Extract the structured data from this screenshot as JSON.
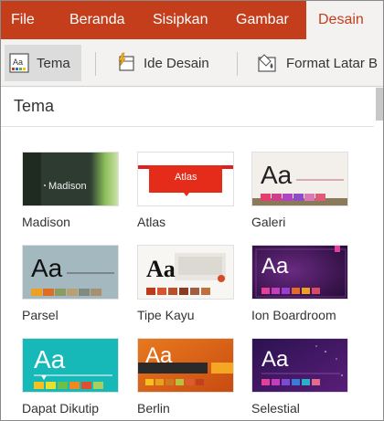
{
  "ribbon": {
    "tabs": [
      {
        "label": "File"
      },
      {
        "label": "Beranda"
      },
      {
        "label": "Sisipkan"
      },
      {
        "label": "Gambar"
      },
      {
        "label": "Desain"
      }
    ],
    "active_tab": "Desain"
  },
  "toolbar": {
    "theme_label": "Tema",
    "design_ideas_label": "Ide Desain",
    "format_background_label": "Format Latar B"
  },
  "panel": {
    "title": "Tema",
    "themes": [
      {
        "label": "Madison",
        "sample": "Madison"
      },
      {
        "label": "Atlas",
        "sample": "Atlas"
      },
      {
        "label": "Galeri",
        "sample": "Aa"
      },
      {
        "label": "Parsel",
        "sample": "Aa"
      },
      {
        "label": "Tipe Kayu",
        "sample": "Aa"
      },
      {
        "label": "Ion Boardroom",
        "sample": "Aa"
      },
      {
        "label": "Dapat Dikutip",
        "sample": "Aa"
      },
      {
        "label": "Berlin",
        "sample": "Aa"
      },
      {
        "label": "Selestial",
        "sample": "Aa"
      }
    ]
  },
  "colors": {
    "ribbon": "#c43e1c",
    "toolbar_bg": "#f3f2f1",
    "text": "#333333"
  },
  "icons": {
    "theme": "theme-icon",
    "design_ideas": "design-ideas-icon",
    "format_background": "format-background-icon"
  }
}
